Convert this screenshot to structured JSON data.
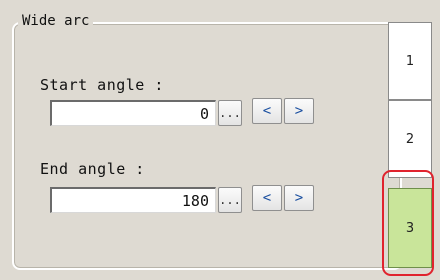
{
  "panel": {
    "title": "Wide arc"
  },
  "start_angle": {
    "label": "Start angle :",
    "value": "0",
    "ellipsis_label": "...",
    "dec_label": "<",
    "inc_label": ">"
  },
  "end_angle": {
    "label": "End angle :",
    "value": "180",
    "ellipsis_label": "...",
    "dec_label": "<",
    "inc_label": ">"
  },
  "tabs": [
    {
      "label": "1"
    },
    {
      "label": "2"
    },
    {
      "label": "3",
      "active": true
    }
  ],
  "colors": {
    "background": "#dedad2",
    "active_tab": "#c9e59a",
    "highlight": "#e0232e"
  }
}
